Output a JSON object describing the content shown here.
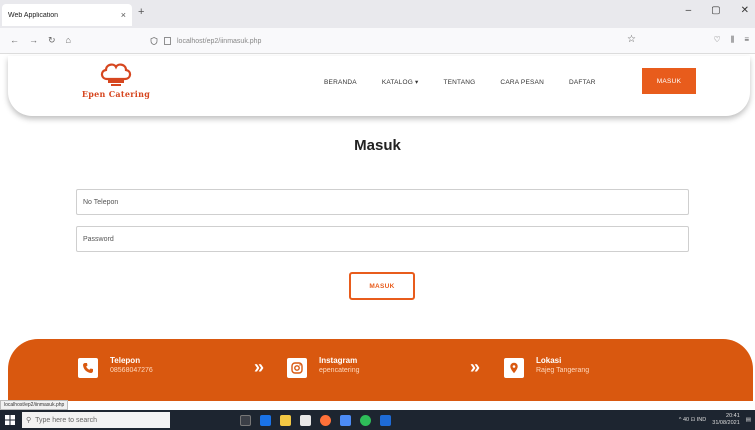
{
  "browser": {
    "tab_title": "Web Application",
    "tab_close": "×",
    "new_tab": "+",
    "controls": [
      "–",
      "▢",
      "✕"
    ],
    "url": "localhost/ep2/iinmasuk.php",
    "nav": [
      "←",
      "→",
      "↻",
      "⌂"
    ]
  },
  "header": {
    "brand": "Epen Catering",
    "menu": [
      "BERANDA",
      "KATALOG ▾",
      "TENTANG",
      "CARA PESAN",
      "DAFTAR"
    ],
    "login_button": "MASUK"
  },
  "form": {
    "title": "Masuk",
    "phone_placeholder": "No Telepon",
    "password_placeholder": "Password",
    "submit_label": "MASUK"
  },
  "footer": {
    "items": [
      {
        "label": "Telepon",
        "value": "08568047276",
        "icon": "phone-icon"
      },
      {
        "label": "Instagram",
        "value": "epencatering",
        "icon": "instagram-icon"
      },
      {
        "label": "Lokasi",
        "value": "Rajeg Tangerang",
        "icon": "location-icon"
      }
    ],
    "arrow": "»"
  },
  "status_url": "localhost/ep2/iinmasuk.php",
  "taskbar": {
    "search_placeholder": "Type here to search",
    "time": "20:41",
    "date": "31/08/2021",
    "tray": "^ 40 ⊡ IND"
  },
  "colors": {
    "accent": "#e85c1c",
    "footer": "#d9580f",
    "taskbar": "#1d2530"
  }
}
